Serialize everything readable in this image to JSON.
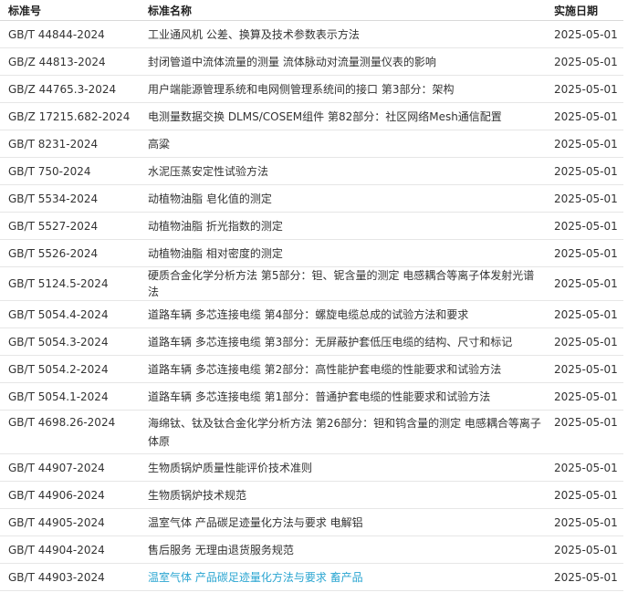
{
  "table": {
    "headers": {
      "code": "标准号",
      "name": "标准名称",
      "date": "实施日期"
    },
    "rows": [
      {
        "code": "GB/T 44844-2024",
        "name": "工业通风机 公差、换算及技术参数表示方法",
        "date": "2025-05-01"
      },
      {
        "code": "GB/Z 44813-2024",
        "name": "封闭管道中流体流量的测量 流体脉动对流量测量仪表的影响",
        "date": "2025-05-01"
      },
      {
        "code": "GB/Z 44765.3-2024",
        "name": "用户端能源管理系统和电网侧管理系统间的接口 第3部分：架构",
        "date": "2025-05-01"
      },
      {
        "code": "GB/Z 17215.682-2024",
        "name": "电测量数据交换 DLMS/COSEM组件 第82部分：社区网络Mesh通信配置",
        "date": "2025-05-01"
      },
      {
        "code": "GB/T 8231-2024",
        "name": "高粱",
        "date": "2025-05-01"
      },
      {
        "code": "GB/T 750-2024",
        "name": "水泥压蒸安定性试验方法",
        "date": "2025-05-01"
      },
      {
        "code": "GB/T 5534-2024",
        "name": "动植物油脂 皂化值的测定",
        "date": "2025-05-01"
      },
      {
        "code": "GB/T 5527-2024",
        "name": "动植物油脂 折光指数的测定",
        "date": "2025-05-01"
      },
      {
        "code": "GB/T 5526-2024",
        "name": "动植物油脂 相对密度的测定",
        "date": "2025-05-01"
      },
      {
        "code": "GB/T 5124.5-2024",
        "name": "硬质合金化学分析方法 第5部分：钽、铌含量的测定 电感耦合等离子体发射光谱法",
        "date": "2025-05-01"
      },
      {
        "code": "GB/T 5054.4-2024",
        "name": "道路车辆 多芯连接电缆 第4部分：螺旋电缆总成的试验方法和要求",
        "date": "2025-05-01"
      },
      {
        "code": "GB/T 5054.3-2024",
        "name": "道路车辆 多芯连接电缆 第3部分：无屏蔽护套低压电缆的结构、尺寸和标记",
        "date": "2025-05-01"
      },
      {
        "code": "GB/T 5054.2-2024",
        "name": "道路车辆 多芯连接电缆 第2部分：高性能护套电缆的性能要求和试验方法",
        "date": "2025-05-01"
      },
      {
        "code": "GB/T 5054.1-2024",
        "name": "道路车辆 多芯连接电缆 第1部分：普通护套电缆的性能要求和试验方法",
        "date": "2025-05-01"
      },
      {
        "code": "GB/T 4698.26-2024",
        "name": "海绵钛、钛及钛合金化学分析方法 第26部分：钽和钨含量的测定 电感耦合等离子体原",
        "date": "2025-05-01"
      },
      {
        "code": "GB/T 44907-2024",
        "name": "生物质锅炉质量性能评价技术准则",
        "date": "2025-05-01"
      },
      {
        "code": "GB/T 44906-2024",
        "name": "生物质锅炉技术规范",
        "date": "2025-05-01"
      },
      {
        "code": "GB/T 44905-2024",
        "name": "温室气体 产品碳足迹量化方法与要求 电解铝",
        "date": "2025-05-01"
      },
      {
        "code": "GB/T 44904-2024",
        "name": "售后服务 无理由退货服务规范",
        "date": "2025-05-01"
      },
      {
        "code": "GB/T 44903-2024",
        "name": "温室气体 产品碳足迹量化方法与要求 畜产品",
        "date": "2025-05-01"
      }
    ],
    "link_color": "#2aa5d1"
  }
}
